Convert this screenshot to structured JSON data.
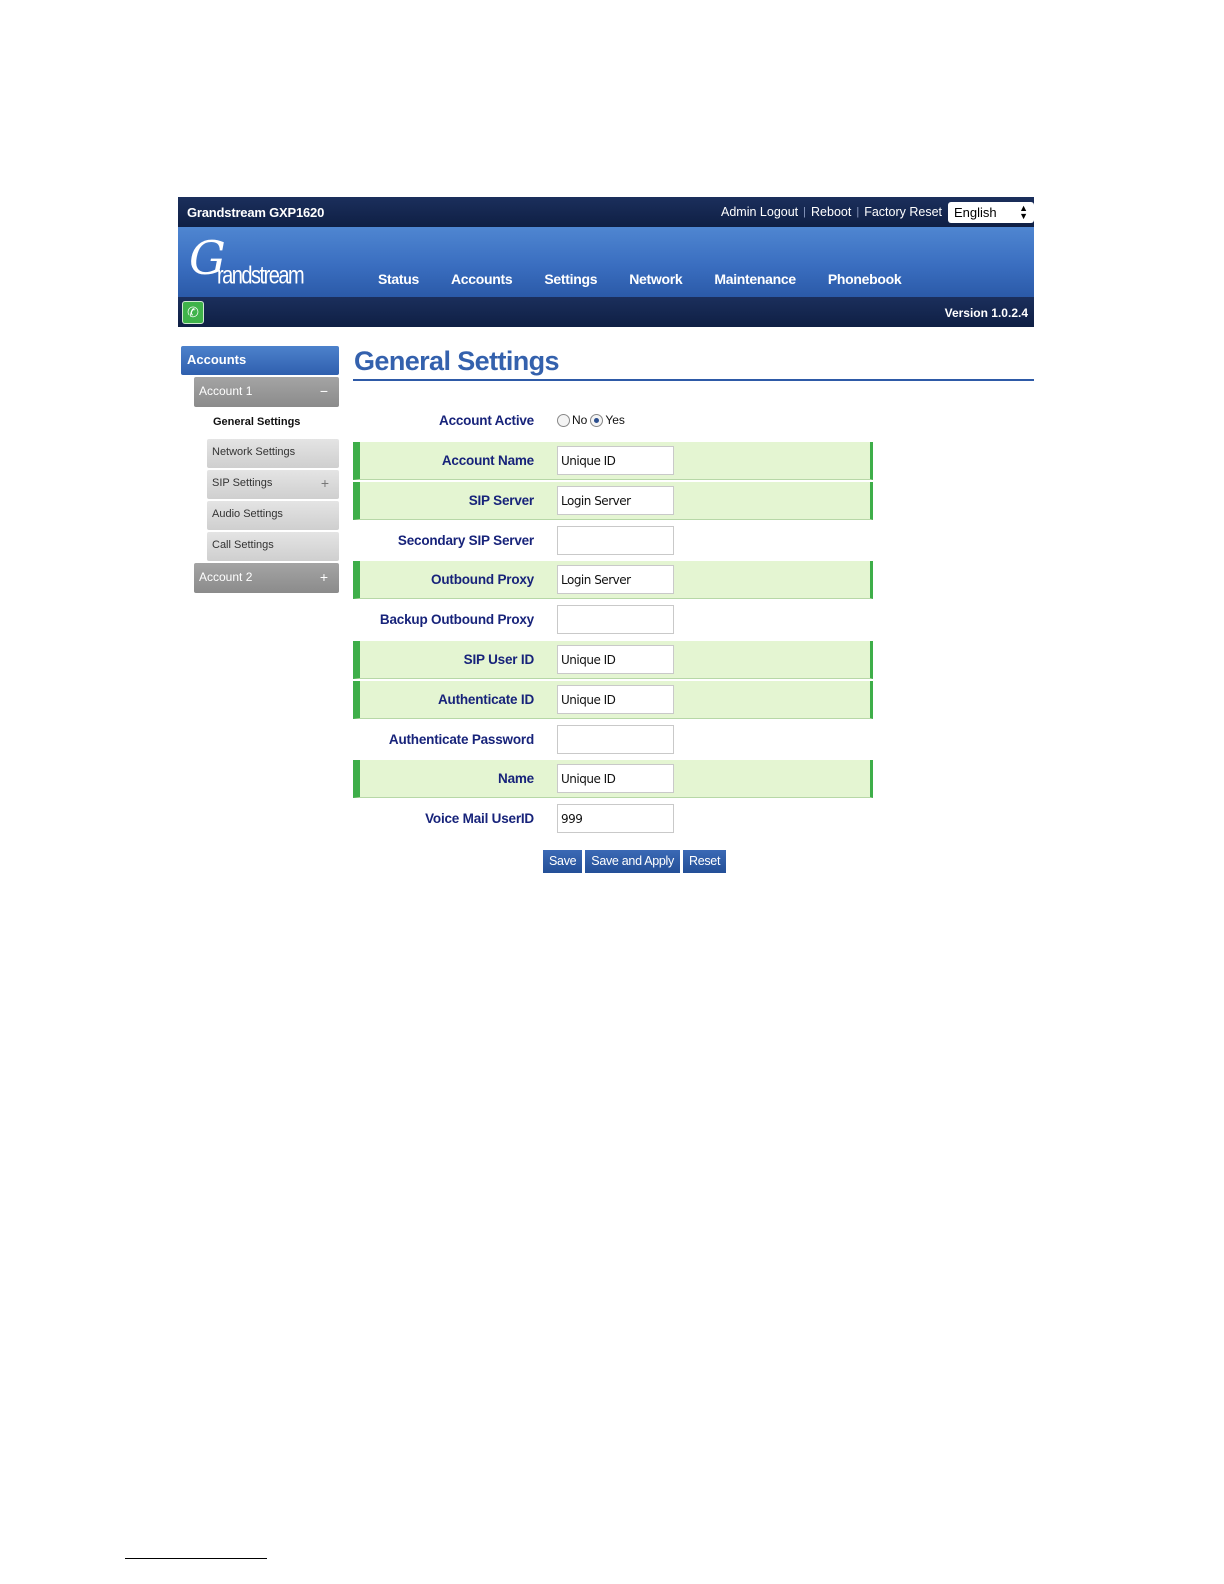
{
  "header": {
    "model": "Grandstream GXP1620",
    "links": [
      "Admin Logout",
      "Reboot",
      "Factory Reset"
    ],
    "language": "English",
    "logo_big": "G",
    "logo_small": "randstream",
    "version": "Version 1.0.2.4"
  },
  "nav": {
    "tabs": [
      "Status",
      "Accounts",
      "Settings",
      "Network",
      "Maintenance",
      "Phonebook"
    ]
  },
  "sidebar": {
    "heading": "Accounts",
    "account1": "Account 1",
    "account1_toggle": "−",
    "current": "General Settings",
    "items": [
      {
        "label": "Network Settings",
        "toggle": ""
      },
      {
        "label": "SIP Settings",
        "toggle": "+"
      },
      {
        "label": "Audio Settings",
        "toggle": ""
      },
      {
        "label": "Call Settings",
        "toggle": ""
      }
    ],
    "account2": "Account 2",
    "account2_toggle": "+"
  },
  "main": {
    "title": "General Settings",
    "account_active": {
      "label": "Account Active",
      "no": "No",
      "yes": "Yes",
      "selected": "Yes"
    },
    "fields": [
      {
        "label": "Account Name",
        "value": "Unique ID",
        "highlight": true
      },
      {
        "label": "SIP Server",
        "value": "Login Server",
        "highlight": true
      },
      {
        "label": "Secondary SIP Server",
        "value": "",
        "highlight": false
      },
      {
        "label": "Outbound Proxy",
        "value": "Login Server",
        "highlight": true
      },
      {
        "label": "Backup Outbound Proxy",
        "value": "",
        "highlight": false
      },
      {
        "label": "SIP User ID",
        "value": "Unique ID",
        "highlight": true
      },
      {
        "label": "Authenticate ID",
        "value": "Unique ID",
        "highlight": true
      },
      {
        "label": "Authenticate Password",
        "value": "",
        "highlight": false
      },
      {
        "label": "Name",
        "value": "Unique ID",
        "highlight": true
      },
      {
        "label": "Voice Mail UserID",
        "value": "999",
        "highlight": false
      }
    ],
    "buttons": {
      "save": "Save",
      "save_apply": "Save and Apply",
      "reset": "Reset"
    }
  },
  "colors": {
    "accent": "#3461ad",
    "label_text": "#17237a",
    "highlight_row": "#e4f5d2",
    "highlight_border": "#3eae49"
  }
}
